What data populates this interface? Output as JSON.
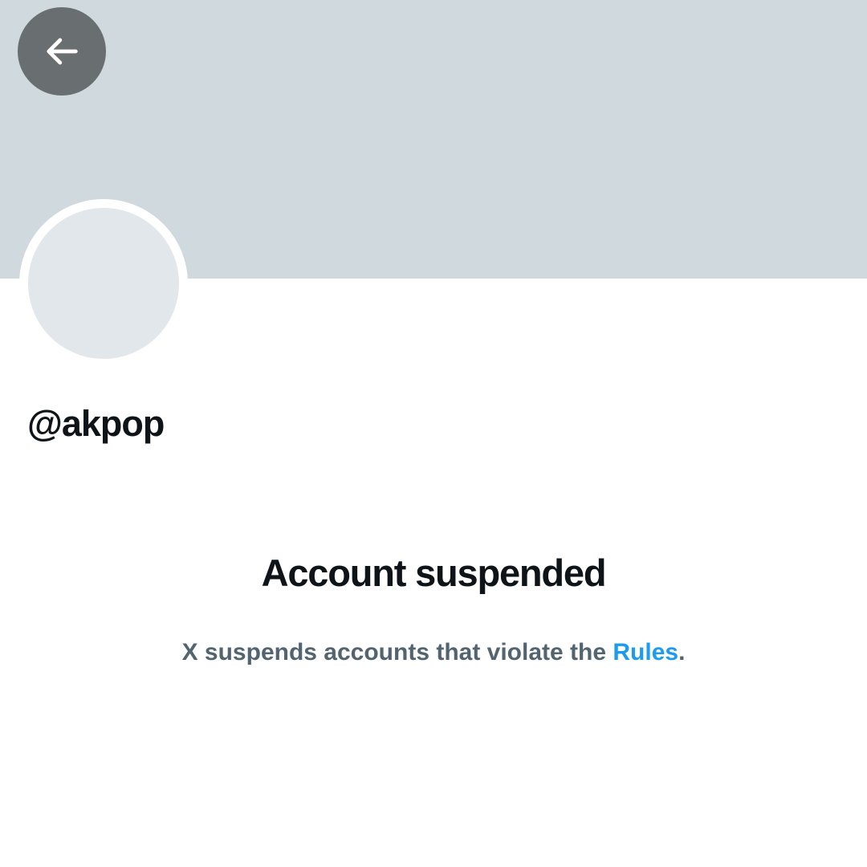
{
  "header": {
    "back_icon": "arrow-left-icon"
  },
  "profile": {
    "handle": "@akpop"
  },
  "suspension": {
    "title": "Account suspended",
    "message_before": "X suspends accounts that violate the ",
    "rules_link": "Rules",
    "message_after": "."
  },
  "colors": {
    "banner": "#cfd9de",
    "back_button": "#696e71",
    "avatar": "#e1e7ea",
    "text_primary": "#0f1419",
    "text_secondary": "#536471",
    "link": "#1d9bf0"
  }
}
